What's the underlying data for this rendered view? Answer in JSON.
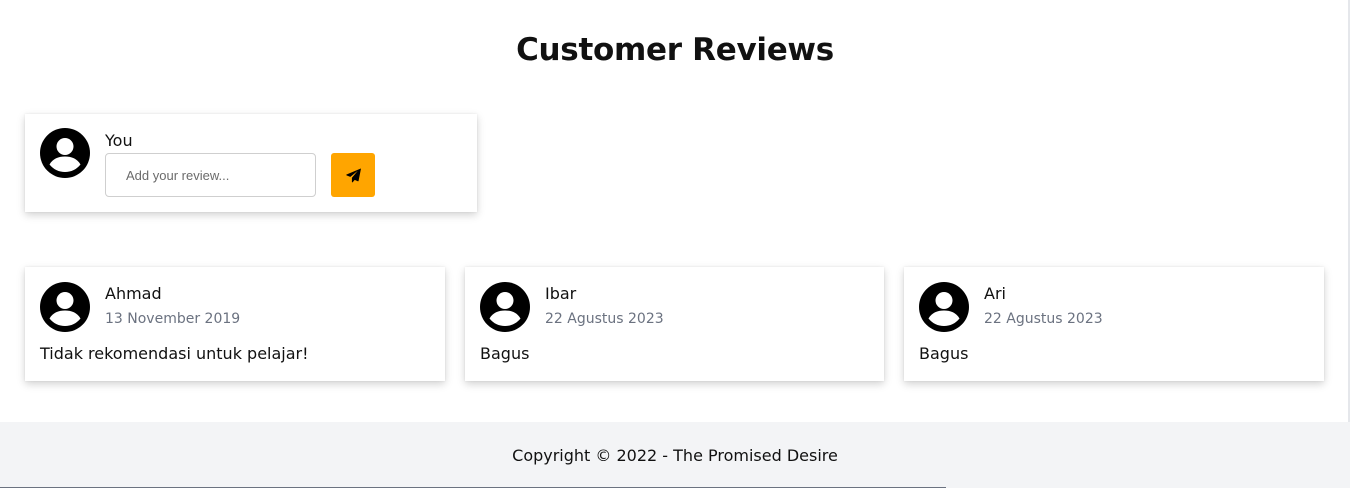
{
  "page": {
    "title": "Customer Reviews"
  },
  "compose": {
    "user_label": "You",
    "placeholder": "Add your review...",
    "value": "",
    "send_icon": "paper-plane-icon",
    "avatar_icon": "user-circle-icon"
  },
  "reviews": [
    {
      "name": "Ahmad",
      "date": "13 November 2019",
      "text": "Tidak rekomendasi untuk pelajar!",
      "avatar_icon": "user-circle-icon"
    },
    {
      "name": "Ibar",
      "date": "22 Agustus 2023",
      "text": "Bagus",
      "avatar_icon": "user-circle-icon"
    },
    {
      "name": "Ari",
      "date": "22 Agustus 2023",
      "text": "Bagus",
      "avatar_icon": "user-circle-icon"
    }
  ],
  "footer": {
    "copyright": "Copyright © 2022 - The Promised Desire"
  },
  "colors": {
    "accent": "#ffa500",
    "date_text": "#6b7280",
    "footer_bg": "#f3f4f6"
  }
}
